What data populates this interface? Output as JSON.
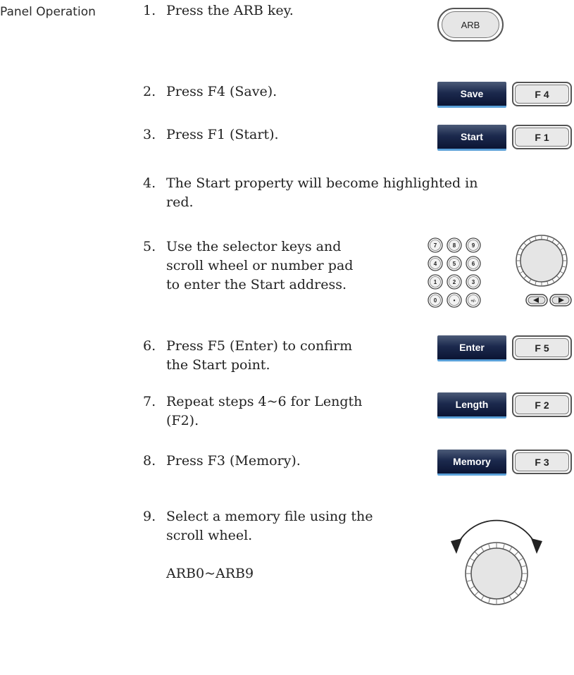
{
  "section": {
    "label": "Panel Operation"
  },
  "steps": [
    {
      "num": "1.",
      "text": "Press the ARB key."
    },
    {
      "num": "2.",
      "text": "Press F4 (Save)."
    },
    {
      "num": "3.",
      "text": "Press F1 (Start)."
    },
    {
      "num": "4.",
      "text": "The Start property will become highlighted in\nred."
    },
    {
      "num": "5.",
      "text": "Use the selector keys and\nscroll wheel or number pad\nto enter the Start address."
    },
    {
      "num": "6.",
      "text": "Press F5 (Enter) to confirm\nthe Start point."
    },
    {
      "num": "7.",
      "text": "Repeat steps 4~6 for Length\n(F2)."
    },
    {
      "num": "8.",
      "text": "Press F3 (Memory)."
    },
    {
      "num": "9.",
      "text": "Select a memory file using the\nscroll wheel."
    }
  ],
  "range_text": "ARB0~ARB9",
  "keys": {
    "arb": "ARB",
    "save": {
      "soft": "Save",
      "fkey": "F 4"
    },
    "start": {
      "soft": "Start",
      "fkey": "F 1"
    },
    "enter": {
      "soft": "Enter",
      "fkey": "F 5"
    },
    "length": {
      "soft": "Length",
      "fkey": "F 2"
    },
    "memory": {
      "soft": "Memory",
      "fkey": "F 3"
    }
  },
  "numpad": [
    "7",
    "8",
    "9",
    "4",
    "5",
    "6",
    "1",
    "2",
    "3",
    "0",
    "•",
    "+/-"
  ],
  "icons": [
    "scroll-wheel-icon",
    "left-arrow-key-icon",
    "right-arrow-key-icon",
    "rotation-arrows-icon"
  ],
  "colors": {
    "softkey_top": "#4c5b78",
    "softkey_bottom": "#0b1433",
    "softkey_underline": "#5aa0d8"
  }
}
